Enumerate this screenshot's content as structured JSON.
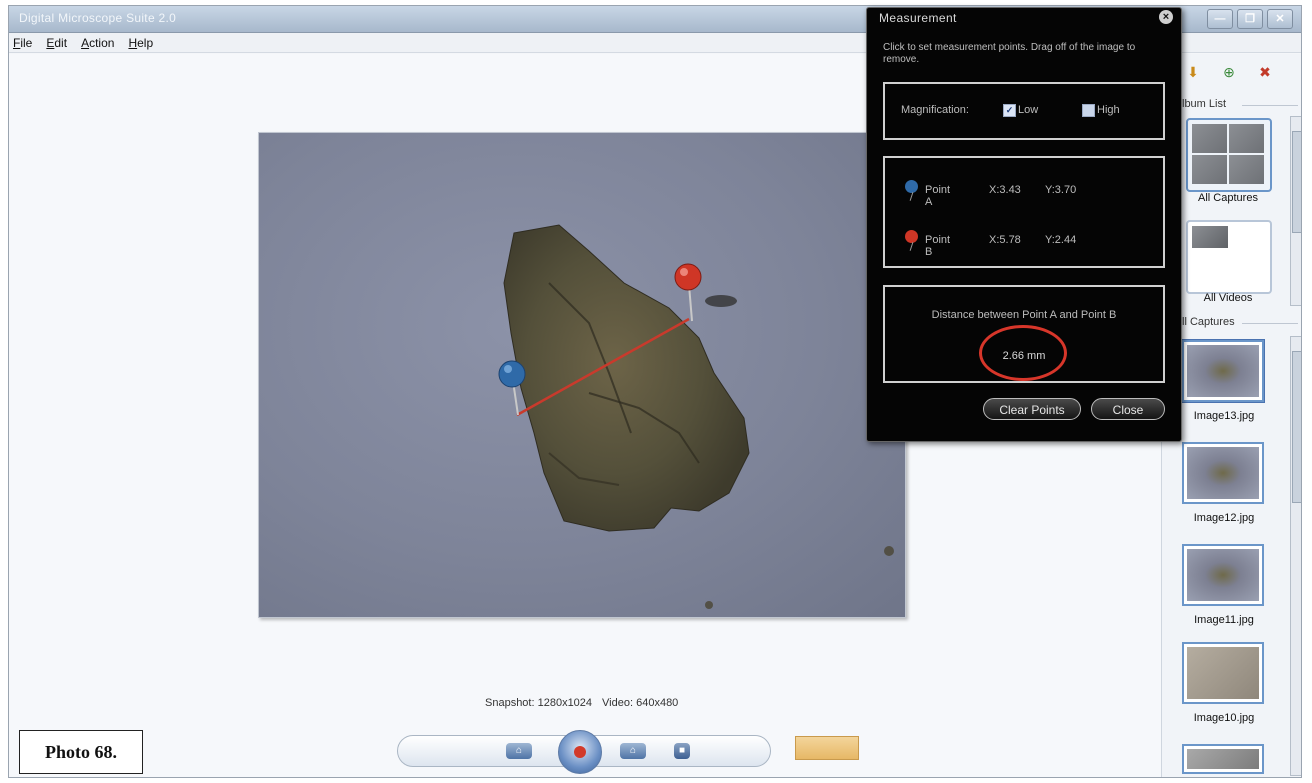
{
  "window": {
    "title": "Digital Microscope Suite 2.0",
    "min_glyph": "—",
    "restore_glyph": "❐",
    "close_glyph": "✕"
  },
  "menu": [
    "File",
    "Edit",
    "Action",
    "Help"
  ],
  "viewer": {
    "status": {
      "snapshot": "Snapshot: 1280x1024",
      "video": "Video: 640x480"
    }
  },
  "caption": "Photo 68.",
  "controls": {
    "left_glyph": "⌂",
    "right_glyph": "⌂",
    "square_glyph": "■"
  },
  "right_panel": {
    "toolbar_glyphs": [
      "⬇",
      "⊕",
      "✖"
    ],
    "album_list_label": "lbum List",
    "albums": [
      "All Captures",
      "All Videos"
    ],
    "captures_label": "ll Captures",
    "captures": [
      "Image13.jpg",
      "Image12.jpg",
      "Image11.jpg",
      "Image10.jpg"
    ]
  },
  "dialog": {
    "title": "Measurement",
    "close_glyph": "×",
    "hint": "Click to set measurement points. Drag off of the image to remove.",
    "magnification": {
      "label": "Magnification:",
      "options": [
        {
          "label": "Low",
          "checked": true,
          "glyph": "✓"
        },
        {
          "label": "High",
          "checked": false,
          "glyph": ""
        }
      ]
    },
    "points": [
      {
        "name": "Point A",
        "x": "X:3.43",
        "y": "Y:3.70",
        "color": "#2f6aa8"
      },
      {
        "name": "Point B",
        "x": "X:5.78",
        "y": "Y:2.44",
        "color": "#cf3626"
      }
    ],
    "distance_label": "Distance between Point A and Point B",
    "distance_value": "2.66 mm",
    "buttons": {
      "clear": "Clear Points",
      "close": "Close"
    }
  },
  "colors": {
    "accent": "#6b96c9",
    "highlight_ring": "#d7362a",
    "dialog_bg": "#050505"
  }
}
